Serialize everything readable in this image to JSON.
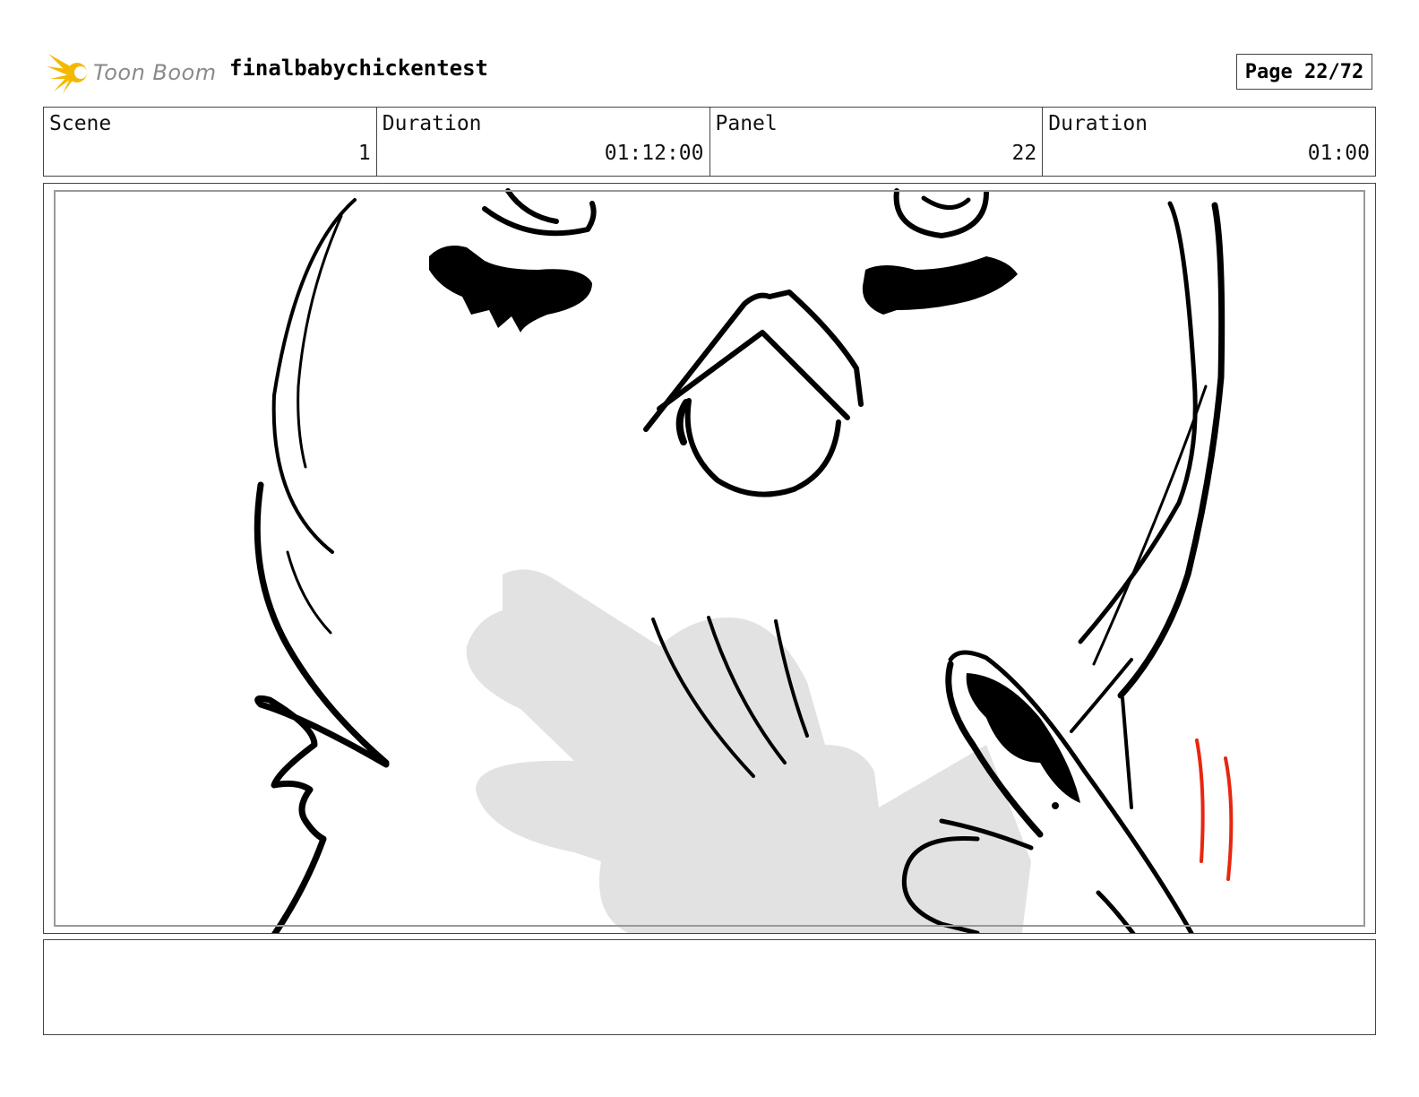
{
  "header": {
    "logo_text": "Toon Boom",
    "project_title": "finalbabychickentest",
    "page_indicator": "Page 22/72"
  },
  "info": {
    "scene_label": "Scene",
    "scene_value": "1",
    "scene_duration_label": "Duration",
    "scene_duration_value": "01:12:00",
    "panel_label": "Panel",
    "panel_value": "22",
    "panel_duration_label": "Duration",
    "panel_duration_value": "01:00"
  },
  "colors": {
    "logo_accent": "#f5b800",
    "ink": "#000000",
    "shadow": "#e2e2e2",
    "motion_lines": "#e8260f"
  },
  "notes": {
    "text": ""
  }
}
